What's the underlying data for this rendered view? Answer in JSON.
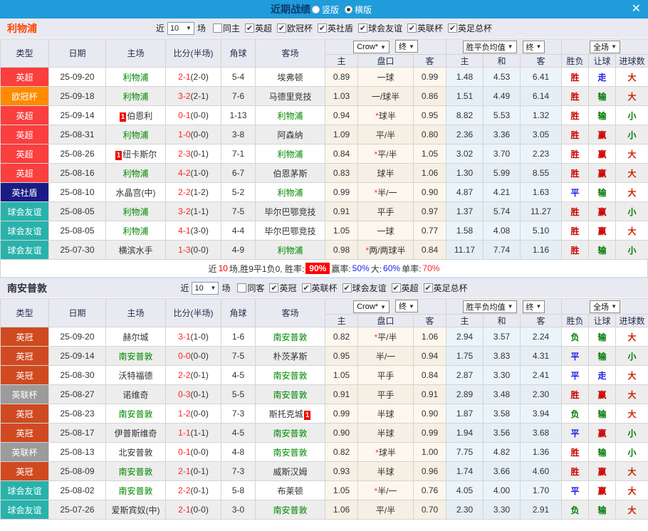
{
  "titlebar": {
    "title": "近期战绩",
    "layout_options": [
      {
        "label": "竖版",
        "selected": false
      },
      {
        "label": "横版",
        "selected": true
      }
    ],
    "close_label": "✕"
  },
  "table_header": {
    "cols": [
      "类型",
      "日期",
      "主场",
      "比分(半场)",
      "角球",
      "客场"
    ],
    "odds_source_dropdown": "Crow*",
    "odds_final_dropdown": "终",
    "mean_dropdown": "胜平负均值",
    "mean_final_dropdown": "终",
    "fullmatch_dropdown": "全场",
    "sub": [
      "主",
      "盘口",
      "客",
      "主",
      "和",
      "客",
      "胜负",
      "让球",
      "进球数"
    ],
    "dropdown_arrow": "▼"
  },
  "league_colors": {
    "英超": "#fb3e3e",
    "欧冠杯": "#ff8a00",
    "英社盾": "#1b1b86",
    "球会友谊": "#28b2ab",
    "英冠": "#cf4a21",
    "英联杯": "#9b9b9b"
  },
  "result_colors": {
    "胜": "#cc0000",
    "平": "#1a1ae6",
    "负": "#007a00",
    "赢": "#cc0000",
    "走": "#1a1ae6",
    "输": "#007a00",
    "大": "#cc2200",
    "小": "#007a00"
  },
  "teams": [
    {
      "name": "利物浦",
      "name_color": "#ff4400",
      "filter": {
        "prefix": "近",
        "count": "10",
        "suffix": "场",
        "same_label": "同主",
        "same_checked": false,
        "leagues": [
          "英超",
          "欧冠杯",
          "英社盾",
          "球会友谊",
          "英联杯",
          "英足总杯"
        ]
      },
      "rows": [
        {
          "league": "英超",
          "date": "25-09-20",
          "home": "利物浦",
          "home_hl": true,
          "home_rank": "",
          "score": "2-1",
          "half": "(2-0)",
          "corner": "5-4",
          "away": "埃弗顿",
          "away_hl": false,
          "away_rank": "",
          "o1": "0.89",
          "handicap": "一球",
          "star": false,
          "o2": "0.99",
          "m1": "1.48",
          "m2": "4.53",
          "m3": "6.41",
          "r1": "胜",
          "r2": "走",
          "r3": "大"
        },
        {
          "league": "欧冠杯",
          "date": "25-09-18",
          "home": "利物浦",
          "home_hl": true,
          "home_rank": "",
          "score": "3-2",
          "half": "(2-1)",
          "corner": "7-6",
          "away": "马德里竞技",
          "away_hl": false,
          "away_rank": "",
          "o1": "1.03",
          "handicap": "一/球半",
          "star": false,
          "o2": "0.86",
          "m1": "1.51",
          "m2": "4.49",
          "m3": "6.14",
          "r1": "胜",
          "r2": "输",
          "r3": "大"
        },
        {
          "league": "英超",
          "date": "25-09-14",
          "home": "伯恩利",
          "home_hl": false,
          "home_rank": "1",
          "score": "0-1",
          "half": "(0-0)",
          "corner": "1-13",
          "away": "利物浦",
          "away_hl": true,
          "away_rank": "",
          "o1": "0.94",
          "handicap": "球半",
          "star": true,
          "o2": "0.95",
          "m1": "8.82",
          "m2": "5.53",
          "m3": "1.32",
          "r1": "胜",
          "r2": "输",
          "r3": "小"
        },
        {
          "league": "英超",
          "date": "25-08-31",
          "home": "利物浦",
          "home_hl": true,
          "home_rank": "",
          "score": "1-0",
          "half": "(0-0)",
          "corner": "3-8",
          "away": "阿森纳",
          "away_hl": false,
          "away_rank": "",
          "o1": "1.09",
          "handicap": "平/半",
          "star": false,
          "o2": "0.80",
          "m1": "2.36",
          "m2": "3.36",
          "m3": "3.05",
          "r1": "胜",
          "r2": "赢",
          "r3": "小"
        },
        {
          "league": "英超",
          "date": "25-08-26",
          "home": "纽卡斯尔",
          "home_hl": false,
          "home_rank": "1",
          "score": "2-3",
          "half": "(0-1)",
          "corner": "7-1",
          "away": "利物浦",
          "away_hl": true,
          "away_rank": "",
          "o1": "0.84",
          "handicap": "平/半",
          "star": true,
          "o2": "1.05",
          "m1": "3.02",
          "m2": "3.70",
          "m3": "2.23",
          "r1": "胜",
          "r2": "赢",
          "r3": "大"
        },
        {
          "league": "英超",
          "date": "25-08-16",
          "home": "利物浦",
          "home_hl": true,
          "home_rank": "",
          "score": "4-2",
          "half": "(1-0)",
          "corner": "6-7",
          "away": "伯恩茅斯",
          "away_hl": false,
          "away_rank": "",
          "o1": "0.83",
          "handicap": "球半",
          "star": false,
          "o2": "1.06",
          "m1": "1.30",
          "m2": "5.99",
          "m3": "8.55",
          "r1": "胜",
          "r2": "赢",
          "r3": "大"
        },
        {
          "league": "英社盾",
          "date": "25-08-10",
          "home": "水晶宫(中)",
          "home_hl": false,
          "home_rank": "",
          "score": "2-2",
          "half": "(1-2)",
          "corner": "5-2",
          "away": "利物浦",
          "away_hl": true,
          "away_rank": "",
          "o1": "0.99",
          "handicap": "半/一",
          "star": true,
          "o2": "0.90",
          "m1": "4.87",
          "m2": "4.21",
          "m3": "1.63",
          "r1": "平",
          "r2": "输",
          "r3": "大"
        },
        {
          "league": "球会友谊",
          "date": "25-08-05",
          "home": "利物浦",
          "home_hl": true,
          "home_rank": "",
          "score": "3-2",
          "half": "(1-1)",
          "corner": "7-5",
          "away": "毕尔巴鄂竞技",
          "away_hl": false,
          "away_rank": "",
          "o1": "0.91",
          "handicap": "平手",
          "star": false,
          "o2": "0.97",
          "m1": "1.37",
          "m2": "5.74",
          "m3": "11.27",
          "r1": "胜",
          "r2": "赢",
          "r3": "小"
        },
        {
          "league": "球会友谊",
          "date": "25-08-05",
          "home": "利物浦",
          "home_hl": true,
          "home_rank": "",
          "score": "4-1",
          "half": "(3-0)",
          "corner": "4-4",
          "away": "毕尔巴鄂竞技",
          "away_hl": false,
          "away_rank": "",
          "o1": "1.05",
          "handicap": "一球",
          "star": false,
          "o2": "0.77",
          "m1": "1.58",
          "m2": "4.08",
          "m3": "5.10",
          "r1": "胜",
          "r2": "赢",
          "r3": "大"
        },
        {
          "league": "球会友谊",
          "date": "25-07-30",
          "home": "横滨水手",
          "home_hl": false,
          "home_rank": "",
          "score": "1-3",
          "half": "(0-0)",
          "corner": "4-9",
          "away": "利物浦",
          "away_hl": true,
          "away_rank": "",
          "o1": "0.98",
          "handicap": "两/两球半",
          "star": true,
          "o2": "0.84",
          "m1": "11.17",
          "m2": "7.74",
          "m3": "1.16",
          "r1": "胜",
          "r2": "输",
          "r3": "小"
        }
      ],
      "summary": [
        {
          "text": "近",
          "color": "#333333"
        },
        {
          "text": "10",
          "color": "#ff0000"
        },
        {
          "text": "场,胜9平1负0, 胜率:",
          "color": "#333333"
        },
        {
          "text": "90%",
          "color": "#ffffff",
          "bg": "#ff0000"
        },
        {
          "text": " 赢率:",
          "color": "#333333"
        },
        {
          "text": "50%",
          "color": "#2222ee"
        },
        {
          "text": " 大:",
          "color": "#333333"
        },
        {
          "text": "60%",
          "color": "#2222ee"
        },
        {
          "text": " 单率:",
          "color": "#333333"
        },
        {
          "text": "70%",
          "color": "#ff2222"
        }
      ]
    },
    {
      "name": "南安普敦",
      "name_color": "#32323f",
      "filter": {
        "prefix": "近",
        "count": "10",
        "suffix": "场",
        "same_label": "同客",
        "same_checked": false,
        "leagues": [
          "英冠",
          "英联杯",
          "球会友谊",
          "英超",
          "英足总杯"
        ]
      },
      "rows": [
        {
          "league": "英冠",
          "date": "25-09-20",
          "home": "赫尔城",
          "home_hl": false,
          "home_rank": "",
          "score": "3-1",
          "half": "(1-0)",
          "corner": "1-6",
          "away": "南安普敦",
          "away_hl": true,
          "away_rank": "",
          "o1": "0.82",
          "handicap": "平/半",
          "star": true,
          "o2": "1.06",
          "m1": "2.94",
          "m2": "3.57",
          "m3": "2.24",
          "r1": "负",
          "r2": "输",
          "r3": "大"
        },
        {
          "league": "英冠",
          "date": "25-09-14",
          "home": "南安普敦",
          "home_hl": true,
          "home_rank": "",
          "score": "0-0",
          "half": "(0-0)",
          "corner": "7-5",
          "away": "朴茨茅斯",
          "away_hl": false,
          "away_rank": "",
          "o1": "0.95",
          "handicap": "半/一",
          "star": false,
          "o2": "0.94",
          "m1": "1.75",
          "m2": "3.83",
          "m3": "4.31",
          "r1": "平",
          "r2": "输",
          "r3": "小"
        },
        {
          "league": "英冠",
          "date": "25-08-30",
          "home": "沃特福德",
          "home_hl": false,
          "home_rank": "",
          "score": "2-2",
          "half": "(0-1)",
          "corner": "4-5",
          "away": "南安普敦",
          "away_hl": true,
          "away_rank": "",
          "o1": "1.05",
          "handicap": "平手",
          "star": false,
          "o2": "0.84",
          "m1": "2.87",
          "m2": "3.30",
          "m3": "2.41",
          "r1": "平",
          "r2": "走",
          "r3": "大"
        },
        {
          "league": "英联杯",
          "date": "25-08-27",
          "home": "诺维奇",
          "home_hl": false,
          "home_rank": "",
          "score": "0-3",
          "half": "(0-1)",
          "corner": "5-5",
          "away": "南安普敦",
          "away_hl": true,
          "away_rank": "",
          "o1": "0.91",
          "handicap": "平手",
          "star": false,
          "o2": "0.91",
          "m1": "2.89",
          "m2": "3.48",
          "m3": "2.30",
          "r1": "胜",
          "r2": "赢",
          "r3": "大"
        },
        {
          "league": "英冠",
          "date": "25-08-23",
          "home": "南安普敦",
          "home_hl": true,
          "home_rank": "",
          "score": "1-2",
          "half": "(0-0)",
          "corner": "7-3",
          "away": "斯托克城",
          "away_hl": false,
          "away_rank": "1",
          "o1": "0.99",
          "handicap": "半球",
          "star": false,
          "o2": "0.90",
          "m1": "1.87",
          "m2": "3.58",
          "m3": "3.94",
          "r1": "负",
          "r2": "输",
          "r3": "大"
        },
        {
          "league": "英冠",
          "date": "25-08-17",
          "home": "伊普斯维奇",
          "home_hl": false,
          "home_rank": "",
          "score": "1-1",
          "half": "(1-1)",
          "corner": "4-5",
          "away": "南安普敦",
          "away_hl": true,
          "away_rank": "",
          "o1": "0.90",
          "handicap": "半球",
          "star": false,
          "o2": "0.99",
          "m1": "1.94",
          "m2": "3.56",
          "m3": "3.68",
          "r1": "平",
          "r2": "赢",
          "r3": "小"
        },
        {
          "league": "英联杯",
          "date": "25-08-13",
          "home": "北安普敦",
          "home_hl": false,
          "home_rank": "",
          "score": "0-1",
          "half": "(0-0)",
          "corner": "4-8",
          "away": "南安普敦",
          "away_hl": true,
          "away_rank": "",
          "o1": "0.82",
          "handicap": "球半",
          "star": true,
          "o2": "1.00",
          "m1": "7.75",
          "m2": "4.82",
          "m3": "1.36",
          "r1": "胜",
          "r2": "输",
          "r3": "小"
        },
        {
          "league": "英冠",
          "date": "25-08-09",
          "home": "南安普敦",
          "home_hl": true,
          "home_rank": "",
          "score": "2-1",
          "half": "(0-1)",
          "corner": "7-3",
          "away": "威斯汉姆",
          "away_hl": false,
          "away_rank": "",
          "o1": "0.93",
          "handicap": "半球",
          "star": false,
          "o2": "0.96",
          "m1": "1.74",
          "m2": "3.66",
          "m3": "4.60",
          "r1": "胜",
          "r2": "赢",
          "r3": "大"
        },
        {
          "league": "球会友谊",
          "date": "25-08-02",
          "home": "南安普敦",
          "home_hl": true,
          "home_rank": "",
          "score": "2-2",
          "half": "(0-1)",
          "corner": "5-8",
          "away": "布莱顿",
          "away_hl": false,
          "away_rank": "",
          "o1": "1.05",
          "handicap": "半/一",
          "star": true,
          "o2": "0.76",
          "m1": "4.05",
          "m2": "4.00",
          "m3": "1.70",
          "r1": "平",
          "r2": "赢",
          "r3": "大"
        },
        {
          "league": "球会友谊",
          "date": "25-07-26",
          "home": "爱斯宾奴(中)",
          "home_hl": false,
          "home_rank": "",
          "score": "2-1",
          "half": "(0-0)",
          "corner": "3-0",
          "away": "南安普敦",
          "away_hl": true,
          "away_rank": "",
          "o1": "1.06",
          "handicap": "平/半",
          "star": false,
          "o2": "0.70",
          "m1": "2.30",
          "m2": "3.30",
          "m3": "2.91",
          "r1": "负",
          "r2": "输",
          "r3": "大"
        }
      ],
      "summary": null
    }
  ]
}
